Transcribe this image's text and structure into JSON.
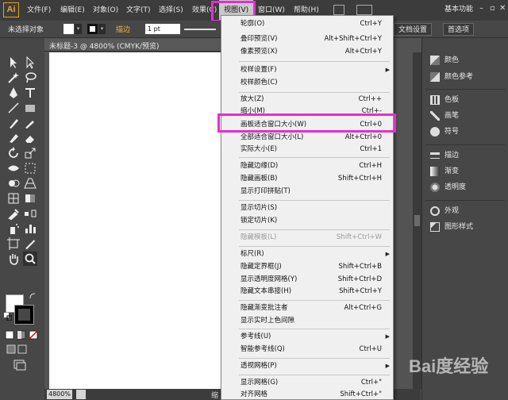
{
  "app": {
    "logo": "Ai"
  },
  "menubar": {
    "items": [
      "文件(F)",
      "编辑(E)",
      "对象(O)",
      "文字(T)",
      "选择(S)",
      "效果(C)",
      "视图(V)",
      "窗口(W)",
      "帮助(H)"
    ],
    "workspace": "基本功能"
  },
  "control_bar": {
    "selection": "未选择对象",
    "stroke_label": "描边",
    "stroke_value": "1 pt",
    "doc_setup": "文档设置",
    "preferences": "首选项"
  },
  "document": {
    "tab_title": "未标题-3 @ 4800% (CMYK/预览)",
    "zoom": "4800%",
    "status_hint": "缩"
  },
  "view_menu": {
    "items": [
      {
        "label": "轮廓(O)",
        "shortcut": "Ctrl+Y"
      },
      {
        "label": "叠印预览(V)",
        "shortcut": "Alt+Shift+Ctrl+Y"
      },
      {
        "label": "像素预览(X)",
        "shortcut": "Alt+Ctrl+Y"
      },
      {
        "label": "校样设置(F)",
        "shortcut": "",
        "submenu": true
      },
      {
        "label": "校样颜色(C)",
        "shortcut": ""
      },
      {
        "label": "放大(Z)",
        "shortcut": "Ctrl++"
      },
      {
        "label": "缩小(M)",
        "shortcut": "Ctrl+-"
      },
      {
        "label": "画板适合窗口大小(W)",
        "shortcut": "Ctrl+0"
      },
      {
        "label": "全部适合窗口大小(L)",
        "shortcut": "Alt+Ctrl+0"
      },
      {
        "label": "实际大小(E)",
        "shortcut": "Ctrl+1"
      },
      {
        "label": "隐藏边缘(D)",
        "shortcut": "Ctrl+H"
      },
      {
        "label": "隐藏画板(B)",
        "shortcut": "Shift+Ctrl+H"
      },
      {
        "label": "显示打印拼贴(T)",
        "shortcut": ""
      },
      {
        "label": "显示切片(S)",
        "shortcut": ""
      },
      {
        "label": "锁定切片(K)",
        "shortcut": ""
      },
      {
        "label": "隐藏模板(L)",
        "shortcut": "Shift+Ctrl+W",
        "disabled": true
      },
      {
        "label": "标尺(R)",
        "shortcut": "",
        "submenu": true
      },
      {
        "label": "隐藏定界框(J)",
        "shortcut": "Shift+Ctrl+B"
      },
      {
        "label": "显示透明度网格(Y)",
        "shortcut": "Shift+Ctrl+D"
      },
      {
        "label": "隐藏文本串接(H)",
        "shortcut": "Shift+Ctrl+Y"
      },
      {
        "label": "隐藏渐变批注者",
        "shortcut": "Alt+Ctrl+G"
      },
      {
        "label": "显示实时上色间隙",
        "shortcut": ""
      },
      {
        "label": "参考线(U)",
        "shortcut": "",
        "submenu": true
      },
      {
        "label": "智能参考线(Q)",
        "shortcut": "Ctrl+U"
      },
      {
        "label": "透视网格(P)",
        "shortcut": "",
        "submenu": true
      },
      {
        "label": "显示网格(G)",
        "shortcut": "Ctrl+\""
      },
      {
        "label": "对齐网格",
        "shortcut": "Shift+Ctrl+\""
      }
    ]
  },
  "panels": {
    "groups": [
      [
        "颜色",
        "颜色参考"
      ],
      [
        "色板",
        "画笔",
        "符号"
      ],
      [
        "描边",
        "渐变",
        "透明度"
      ],
      [
        "外观",
        "图形样式"
      ]
    ]
  },
  "watermark": "Bai度经验",
  "colors": {
    "highlight": "#e22fd0",
    "logo": "#f0a030"
  }
}
